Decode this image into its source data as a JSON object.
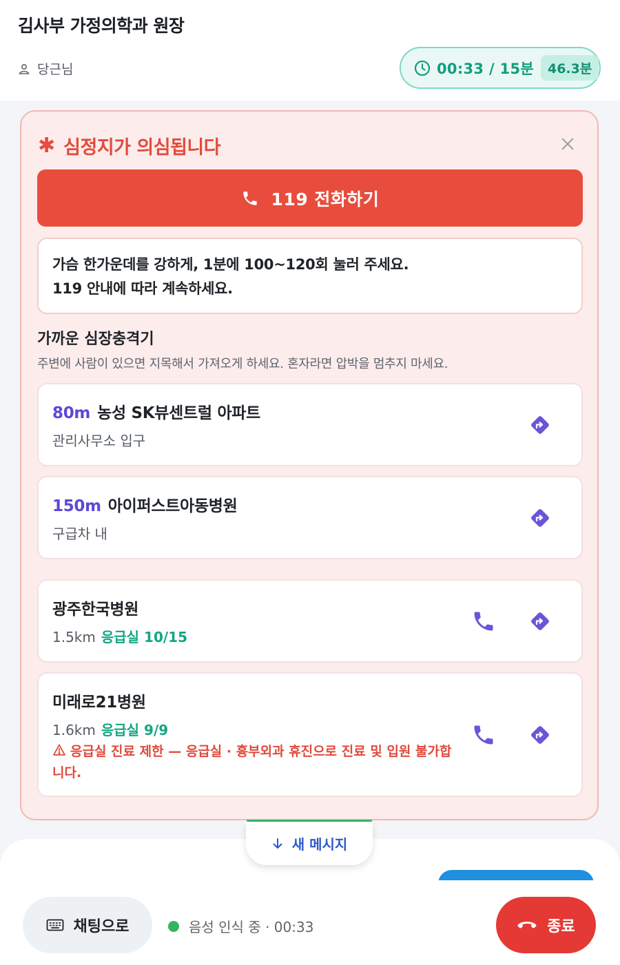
{
  "header": {
    "title": "김사부 가정의학과 원장",
    "user_name": "당근님",
    "timer_text": "00:33 / 15분",
    "timer_badge": "46.3분"
  },
  "alert": {
    "title": "심정지가 의심됩니다",
    "call_button_label": "119 전화하기",
    "instruction_line1": "가슴 한가운데를 강하게, 1분에 100~120회 눌러 주세요.",
    "instruction_line2": "119 안내에 따라 계속하세요.",
    "aed_heading": "가까운 심장충격기",
    "aed_subtext": "주변에 사람이 있으면 지목해서 가져오게 하세요. 혼자라면 압박을 멈추지 마세요.",
    "aed_locations": [
      {
        "distance": "80m",
        "name": "농성 SK뷰센트럴 아파트",
        "detail": "관리사무소 입구"
      },
      {
        "distance": "150m",
        "name": "아이퍼스트아동병원",
        "detail": "구급차 내"
      }
    ],
    "hospitals": [
      {
        "name": "광주한국병원",
        "distance": "1.5km",
        "er_status": "응급실 10/15",
        "warning": ""
      },
      {
        "name": "미래로21병원",
        "distance": "1.6km",
        "er_status": "응급실 9/9",
        "warning": "응급실 진료 제한 — 응급실 · 흉부외과 휴진으로 진료 및 입원 불가합니다."
      }
    ]
  },
  "new_message_label": "새 메시지",
  "bottom": {
    "chat_button_label": "채팅으로",
    "voice_status": "음성 인식 중 · 00:33",
    "end_button_label": "종료"
  },
  "colors": {
    "alert_red": "#e84c3d",
    "accent_teal": "#119e7f",
    "accent_purple": "#5b48d6",
    "end_red": "#e53935"
  },
  "icons": {
    "user": "user-icon",
    "clock": "clock-icon",
    "star": "asterisk-icon",
    "close": "close-icon",
    "phone": "phone-icon",
    "directions": "directions-icon",
    "warning": "warning-icon",
    "arrow_down": "arrow-down-icon",
    "keyboard": "keyboard-icon",
    "hangup": "hangup-icon"
  }
}
